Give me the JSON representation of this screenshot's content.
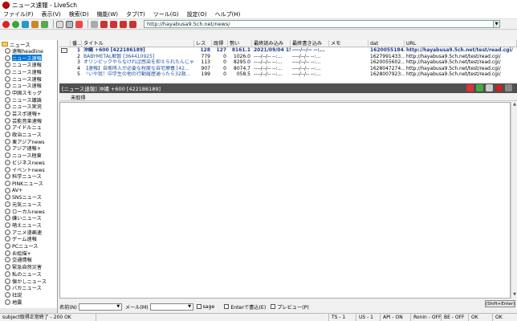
{
  "window": {
    "title": "ニュース速報 - LiveSch"
  },
  "menu": [
    "ファイル(F)",
    "表示(V)",
    "検索(D)",
    "機能(W)",
    "タブ(T)",
    "ツール(G)",
    "設定(O)",
    "ヘルプ(H)"
  ],
  "address": {
    "url": "http://hayabusa9.5ch.net/news/"
  },
  "tree": {
    "root": "ニュース",
    "selected_index": 1,
    "items": [
      "速報headline",
      "ニュース速報",
      "ニュース速報",
      "ニュース速報",
      "ニュース速報",
      "ニュース速報",
      "中国スモッグ",
      "ニュース議論",
      "ニュース実況",
      "芸スポ速報+",
      "芸能音楽速報",
      "アイドルニュ",
      "政治ニュース",
      "東アジアnews",
      "アジア速報+",
      "ニュース極東",
      "ビジネスnews",
      "イベントnews",
      "科学ニュース",
      "PINKニュース",
      "AV+",
      "SNSニュース",
      "元気ニュース",
      "ローカルnews",
      "嫌いニュース",
      "萌えニュース",
      "アニメ漫画速",
      "ゲーム速報",
      "PCニュース",
      "お絵描+",
      "交通情報",
      "緊急自然災害",
      "私のニュース",
      "懐かしニュース",
      "バカニュース",
      "社説",
      "地震"
    ]
  },
  "threads": {
    "headers": [
      "番...",
      "タイトル",
      "レス",
      "既得",
      "勢い",
      "最終読み込み",
      "最終書き込み",
      "メモ",
      "dat",
      "URL"
    ],
    "rows": [
      {
        "no": "1",
        "title": "沖縄 +600 [422186189]",
        "res": "128",
        "got": "127",
        "pace": "8161.1",
        "last": "2021/09/04 15...",
        "write": "----/--/-- --:...",
        "memo": "",
        "dat": "1620055184...",
        "url": "http://hayabusa9.5ch.net/test/read.cgi/",
        "bold": true
      },
      {
        "no": "2",
        "title": "BABYMETAL解散 [364410925]",
        "res": "779",
        "got": "0",
        "pace": "1026.0",
        "last": "----/--/-- --:...",
        "write": "----/--/-- --:...",
        "memo": "",
        "dat": "1627991433...",
        "url": "http://hayabusa9.5ch.net/test/read.cgi/",
        "bold": false
      },
      {
        "no": "3",
        "title": "オリンピックやらなければ感染を抑えられたんじゃ...",
        "res": "113",
        "got": "0",
        "pace": "8295.0",
        "last": "----/--/-- --:...",
        "write": "----/--/-- --:...",
        "memo": "",
        "dat": "1620055602...",
        "url": "http://hayabusa9.5ch.net/test/read.cgi/",
        "bold": false
      },
      {
        "no": "4",
        "title": "【速報】自衛隊入が必要な程度な自宅療養 [42...",
        "res": "907",
        "got": "0",
        "pace": "8074.7",
        "last": "----/--/-- --:...",
        "write": "----/--/-- --:...",
        "memo": "",
        "dat": "1628047274...",
        "url": "http://hayabusa9.5ch.net/test/read.cgi/",
        "bold": false
      },
      {
        "no": "5",
        "title": "「いや我！中学生の他の行動履歴通ったら32政...",
        "res": "199",
        "got": "0",
        "pace": "058.5",
        "last": "----/--/-- --:...",
        "write": "----/--/-- --:...",
        "memo": "",
        "dat": "1628007923...",
        "url": "http://hayabusa9.5ch.net/test/read.cgi/",
        "bold": false
      }
    ]
  },
  "thread_view": {
    "header": "[ニュース速報] 沖縄 +600 [422186189]",
    "tab": "未取得"
  },
  "post": {
    "name_label": "名前(N)",
    "mail_label": "メール(M)",
    "sage_label": "sage",
    "enter_label": "Enterで書込(E)",
    "preview_label": "プレビュー(P)",
    "submit_label": "(Shift+Enter)"
  },
  "status": {
    "cells": [
      "subject取得正常終了 - 200 OK",
      "",
      "TS - 1",
      "US - 1",
      "API - ON",
      "Ronin - OFF",
      "BE - OFF",
      "OK",
      "OK"
    ]
  },
  "colors": {
    "selection": "#0078d7",
    "thread_header": "#505050",
    "link": "#1d4f9c"
  }
}
